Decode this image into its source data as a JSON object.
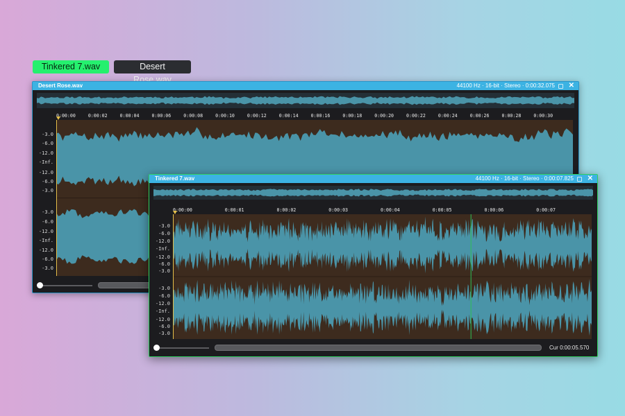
{
  "tabs": [
    {
      "label": "Tinkered 7.wav",
      "active": true
    },
    {
      "label": "Desert Rose.wav",
      "active": false
    }
  ],
  "windows": [
    {
      "id": "w1",
      "title": "Desert Rose.wav",
      "info": "44100 Hz · 16-bit · Stereo · 0:00:32.075",
      "close": "✕",
      "ticks": [
        "0:00:00",
        "0:00:02",
        "0:00:04",
        "0:00:06",
        "0:00:08",
        "0:00:10",
        "0:00:12",
        "0:00:14",
        "0:00:16",
        "0:00:18",
        "0:00:20",
        "0:00:22",
        "0:00:24",
        "0:00:26",
        "0:00:28",
        "0:00:30"
      ],
      "db_labels": [
        "-3.0",
        "-6.0",
        "-12.0",
        "-Inf.",
        "-12.0",
        "-6.0",
        "-3.0"
      ],
      "cursor_text": ""
    },
    {
      "id": "w2",
      "title": "Tinkered 7.wav",
      "info": "44100 Hz · 16-bit · Stereo · 0:00:07.825",
      "close": "✕",
      "ticks": [
        "0:00:00",
        "0:00:01",
        "0:00:02",
        "0:00:03",
        "0:00:04",
        "0:00:05",
        "0:00:06",
        "0:00:07"
      ],
      "db_labels": [
        "-3.0",
        "-6.0",
        "-12.0",
        "-Inf.",
        "-12.0",
        "-6.0",
        "-3.0"
      ],
      "cursor_text": "Cur 0:00:05.570",
      "playhead_seconds": 5.57,
      "duration_seconds": 7.825
    }
  ],
  "colors": {
    "waveform": "#4a94a8",
    "wave_bg": "#3d2b1e",
    "title_bar_blue": "#3cb3e3",
    "active_tab": "#25f06e",
    "active_frame": "#2fd060",
    "playhead": "#2fbf55"
  },
  "icons": [
    "lock-icon",
    "close-icon",
    "volume-knob-icon",
    "play-marker-icon"
  ]
}
